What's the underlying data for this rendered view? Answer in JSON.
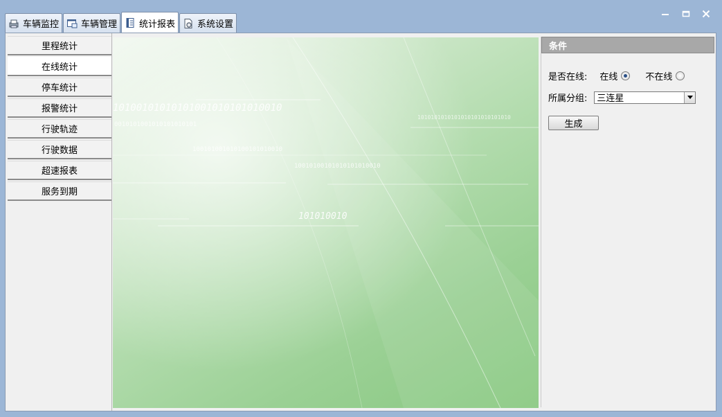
{
  "tabs": [
    {
      "label": "车辆监控",
      "icon": "monitor-printer-icon"
    },
    {
      "label": "车辆管理",
      "icon": "vehicle-window-icon"
    },
    {
      "label": "统计报表",
      "icon": "report-book-icon",
      "active": true
    },
    {
      "label": "系统设置",
      "icon": "settings-gear-icon"
    }
  ],
  "window_controls": {
    "minimize": "minimize-icon",
    "maximize": "maximize-icon",
    "close": "close-icon"
  },
  "sidebar": {
    "items": [
      {
        "label": "里程统计"
      },
      {
        "label": "在线统计",
        "active": true
      },
      {
        "label": "停车统计"
      },
      {
        "label": "报警统计"
      },
      {
        "label": "行驶轨迹"
      },
      {
        "label": "行驶数据"
      },
      {
        "label": "超速报表"
      },
      {
        "label": "服务到期"
      }
    ]
  },
  "banner": {
    "binary_strings": [
      "10100101010101001010101010010",
      "0010101001010101010101",
      "100101001010100101010010",
      "10010100101010101010010",
      "101010010",
      "1010101010101010101010101010"
    ]
  },
  "conditions": {
    "header": "条件",
    "online_label": "是否在线:",
    "online_option": "在线",
    "offline_option": "不在线",
    "selected_option": "在线",
    "group_label": "所属分组:",
    "group_value": "三连星",
    "generate_button": "生成"
  },
  "colors": {
    "window_bg": "#9cb6d6",
    "banner_green": "#9ad094",
    "panel_header": "#a8a8a8"
  }
}
